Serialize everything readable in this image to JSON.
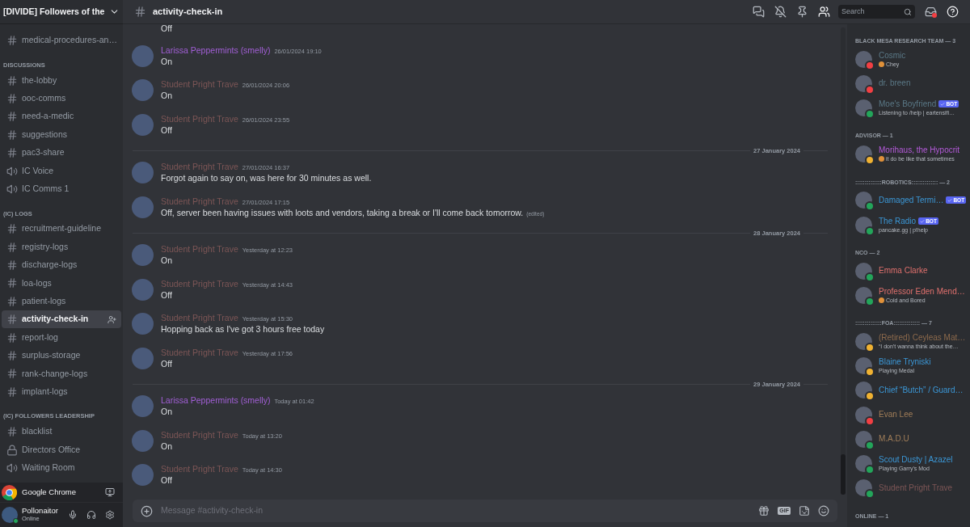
{
  "server": {
    "name": "[DIVIDE] Followers of the"
  },
  "sidebar": {
    "channels": [
      {
        "name": "medical-procedures-an…",
        "kind": "text",
        "selected": false
      }
    ],
    "categories": [
      {
        "name": "DISCUSSIONS",
        "channels": [
          {
            "name": "the-lobby",
            "kind": "text",
            "selected": false
          },
          {
            "name": "ooc-comms",
            "kind": "text",
            "selected": false
          },
          {
            "name": "need-a-medic",
            "kind": "text",
            "selected": false
          },
          {
            "name": "suggestions",
            "kind": "text",
            "selected": false
          },
          {
            "name": "pac3-share",
            "kind": "text",
            "selected": false
          },
          {
            "name": "IC Voice",
            "kind": "voice",
            "selected": false
          },
          {
            "name": "IC Comms 1",
            "kind": "voice",
            "selected": false
          }
        ]
      },
      {
        "name": "(IC) LOGS",
        "channels": [
          {
            "name": "recruitment-guideline",
            "kind": "text",
            "selected": false
          },
          {
            "name": "registry-logs",
            "kind": "text",
            "selected": false
          },
          {
            "name": "discharge-logs",
            "kind": "text",
            "selected": false
          },
          {
            "name": "loa-logs",
            "kind": "text",
            "selected": false
          },
          {
            "name": "patient-logs",
            "kind": "text",
            "selected": false
          },
          {
            "name": "activity-check-in",
            "kind": "text",
            "selected": true
          },
          {
            "name": "report-log",
            "kind": "text",
            "selected": false
          },
          {
            "name": "surplus-storage",
            "kind": "text",
            "selected": false
          },
          {
            "name": "rank-change-logs",
            "kind": "text",
            "selected": false
          },
          {
            "name": "implant-logs",
            "kind": "text",
            "selected": false
          }
        ]
      },
      {
        "name": "(IC) FOLLOWERS LEADERSHIP",
        "channels": [
          {
            "name": "blacklist",
            "kind": "text",
            "selected": false
          },
          {
            "name": "Directors Office",
            "kind": "locked",
            "selected": false
          },
          {
            "name": "Waiting Room",
            "kind": "voice",
            "selected": false
          }
        ]
      }
    ]
  },
  "activity_panel": {
    "app": "Google Chrome"
  },
  "user_panel": {
    "name": "Pollonaitor",
    "status": "Online"
  },
  "channel_header": {
    "name": "activity-check-in",
    "search_placeholder": "Search"
  },
  "messages": [
    {
      "kind": "continuation",
      "text": "Off"
    },
    {
      "kind": "message",
      "author": "Larissa Peppermints (smelly)",
      "color": "#a25fd6",
      "time": "26/01/2024 19:10",
      "text": "On"
    },
    {
      "kind": "message",
      "author": "Student Pright Trave",
      "color": "#7d5656",
      "time": "26/01/2024 20:06",
      "text": "On"
    },
    {
      "kind": "message",
      "author": "Student Pright Trave",
      "color": "#7d5656",
      "time": "26/01/2024 23:55",
      "text": "Off"
    },
    {
      "kind": "divider",
      "label": "27 January 2024"
    },
    {
      "kind": "message",
      "author": "Student Pright Trave",
      "color": "#7d5656",
      "time": "27/01/2024 16:37",
      "text": "Forgot again to say on, was here for 30 minutes as well."
    },
    {
      "kind": "message",
      "author": "Student Pright Trave",
      "color": "#7d5656",
      "time": "27/01/2024 17:15",
      "text": "Off, server been having issues with loots and vendors, taking a break or I'll come back tomorrow.",
      "edited": "(edited)"
    },
    {
      "kind": "divider",
      "label": "28 January 2024"
    },
    {
      "kind": "message",
      "author": "Student Pright Trave",
      "color": "#7d5656",
      "time": "Yesterday at 12:23",
      "text": "On"
    },
    {
      "kind": "message",
      "author": "Student Pright Trave",
      "color": "#7d5656",
      "time": "Yesterday at 14:43",
      "text": "Off"
    },
    {
      "kind": "message",
      "author": "Student Pright Trave",
      "color": "#7d5656",
      "time": "Yesterday at 15:30",
      "text": "Hopping back as I've got 3 hours free today"
    },
    {
      "kind": "message",
      "author": "Student Pright Trave",
      "color": "#7d5656",
      "time": "Yesterday at 17:56",
      "text": "Off"
    },
    {
      "kind": "divider",
      "label": "29 January 2024"
    },
    {
      "kind": "message",
      "author": "Larissa Peppermints (smelly)",
      "color": "#a25fd6",
      "time": "Today at 01:42",
      "text": "On"
    },
    {
      "kind": "message",
      "author": "Student Pright Trave",
      "color": "#7d5656",
      "time": "Today at 13:20",
      "text": "On"
    },
    {
      "kind": "message",
      "author": "Student Pright Trave",
      "color": "#7d5656",
      "time": "Today at 14:30",
      "text": "Off"
    }
  ],
  "composer": {
    "placeholder": "Message #activity-check-in",
    "gif_label": "GIF"
  },
  "member_groups": [
    {
      "header": "BLACK MESA RESEARCH TEAM — 3",
      "members": [
        {
          "name": "Cosmic",
          "color": "#5a7886",
          "status": {
            "color": "#f23f43"
          },
          "activity": "Chey",
          "emoji": true
        },
        {
          "name": "dr. breen",
          "color": "#5a7886",
          "status": {
            "color": "#f23f43"
          }
        },
        {
          "name": "Moe's Boyfriend",
          "color": "#5a7886",
          "status": {
            "color": "#23a55a"
          },
          "bot": "BOT",
          "activity": "Listening to /help | eartensifi…"
        }
      ]
    },
    {
      "header": "ADVISOR — 1",
      "members": [
        {
          "name": "Morihaus, the Hypocrit",
          "color": "#b45ad9",
          "status": {
            "color": "#f0b232"
          },
          "activity": "it do be like that sometimes",
          "emoji": true
        }
      ]
    },
    {
      "header": "::::::::::::::ROBOTICS:::::::::::::: — 2",
      "members": [
        {
          "name": "Damaged Termi…",
          "color": "#3b97d6",
          "status": {
            "color": "#23a55a"
          },
          "bot": "BOT"
        },
        {
          "name": "The Radio",
          "color": "#3b97d6",
          "status": {
            "color": "#23a55a"
          },
          "bot": "BOT",
          "activity": "pancake.gg | p!help"
        }
      ]
    },
    {
      "header": "NCO — 2",
      "members": [
        {
          "name": "Emma Clarke",
          "color": "#e0706d",
          "status": {
            "color": "#23a55a"
          }
        },
        {
          "name": "Professor Eden Mend…",
          "color": "#e0706d",
          "status": {
            "color": "#23a55a"
          },
          "activity": "Cold and Bored",
          "emoji": true
        }
      ]
    },
    {
      "header": "::::::::::::::FOA:::::::::::::: — 7",
      "members": [
        {
          "name": "(Retired) Ceyleas Mat…",
          "color": "#8d6a4c",
          "status": {
            "color": "#f0b232"
          },
          "activity": "“I don't wanna think about the…"
        },
        {
          "name": "Blaine Tryniski",
          "color": "#3b97d6",
          "status": {
            "color": "#f0b232"
          },
          "activity": "Playing Medal"
        },
        {
          "name": "Chief “Butch” / Guard…",
          "color": "#3b97d6",
          "status": {
            "color": "#f0b232"
          }
        },
        {
          "name": "Evan Lee",
          "color": "#a07d58",
          "status": {
            "color": "#f23f43"
          }
        },
        {
          "name": "M.A.D.U",
          "color": "#a07d58",
          "status": {
            "color": "#23a55a"
          }
        },
        {
          "name": "Scout Dusty | Azazel",
          "color": "#3b97d6",
          "status": {
            "color": "#23a55a"
          },
          "activity": "Playing Garry's Mod"
        },
        {
          "name": "Student Pright Trave",
          "color": "#7d5656",
          "status": {
            "color": "#23a55a"
          }
        }
      ]
    },
    {
      "header": "ONLINE — 1"
    }
  ]
}
